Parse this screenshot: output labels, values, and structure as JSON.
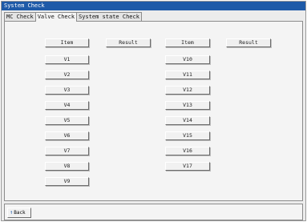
{
  "window": {
    "title": "System Check"
  },
  "tabs": [
    {
      "label": "MC Check",
      "active": false
    },
    {
      "label": "Valve Check",
      "active": true
    },
    {
      "label": "System state Check",
      "active": false
    }
  ],
  "table": {
    "headers": {
      "item_left": "Item",
      "result_left": "Result",
      "item_right": "Item",
      "result_right": "Result"
    },
    "left_items": [
      "V1",
      "V2",
      "V3",
      "V4",
      "V5",
      "V6",
      "V7",
      "V8",
      "V9"
    ],
    "right_items": [
      "V10",
      "V11",
      "V12",
      "V13",
      "V14",
      "V15",
      "V16",
      "V17"
    ]
  },
  "footer": {
    "back_label": "Back",
    "back_icon": "up-arrow-icon"
  },
  "colors": {
    "titlebar": "#1e5aa8",
    "background": "#ececec",
    "panel": "#f4f4f4"
  }
}
